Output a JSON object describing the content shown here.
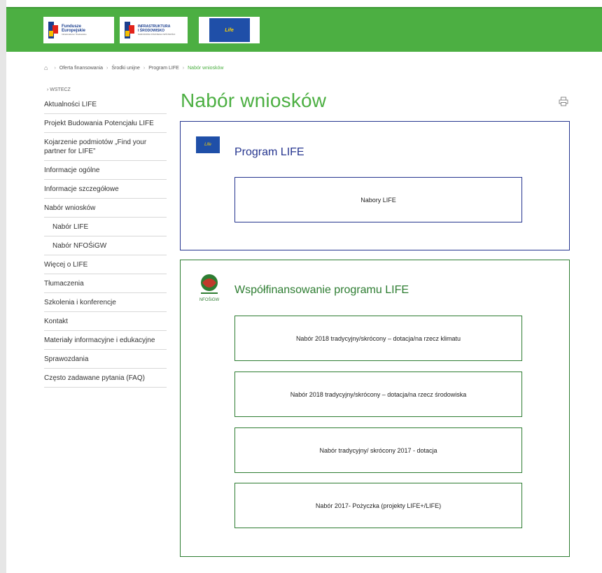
{
  "header": {
    "logo1": {
      "line1": "Fundusze",
      "line2": "Europejskie",
      "line3": "Infrastruktura i Środowisko"
    },
    "logo2": {
      "line1": "INFRASTRUKTURA",
      "line2": "I ŚRODOWISKO",
      "line3": "NARODOWA STRATEGIA SPÓJNOŚCI"
    },
    "logo3": {
      "text": "Life"
    }
  },
  "breadcrumb": {
    "items": [
      "Oferta finansowania",
      "Środki unijne",
      "Program LIFE"
    ],
    "current": "Nabór wniosków"
  },
  "sidebar": {
    "back": "WSTECZ",
    "items": [
      {
        "label": "Aktualności LIFE"
      },
      {
        "label": "Projekt Budowania Potencjału LIFE"
      },
      {
        "label": "Kojarzenie podmiotów „Find your partner for LIFE”"
      },
      {
        "label": "Informacje ogólne"
      },
      {
        "label": "Informacje szczegółowe"
      },
      {
        "label": "Nabór wniosków"
      },
      {
        "label": "Nabór LIFE"
      },
      {
        "label": "Nabór NFOŚiGW"
      },
      {
        "label": "Więcej o LIFE"
      },
      {
        "label": "Tłumaczenia"
      },
      {
        "label": "Szkolenia i konferencje"
      },
      {
        "label": "Kontakt"
      },
      {
        "label": "Materiały informacyjne i edukacyjne"
      },
      {
        "label": "Sprawozdania"
      },
      {
        "label": "Często zadawane pytania (FAQ)"
      }
    ]
  },
  "page": {
    "title": "Nabór wniosków"
  },
  "sections": {
    "life": {
      "title": "Program LIFE",
      "icon_label": "Life",
      "buttons": [
        "Nabory LIFE"
      ]
    },
    "nfos": {
      "title": "Współfinansowanie programu LIFE",
      "icon_label": "NFOŚiGW",
      "buttons": [
        "Nabór 2018 tradycyjny/skrócony – dotacja/na rzecz klimatu",
        "Nabór 2018 tradycyjny/skrócony – dotacja/na rzecz środowiska",
        "Nabór tradycyjny/ skrócony 2017 - dotacja",
        "Nabór 2017- Pożyczka (projekty LIFE+/LIFE)"
      ]
    }
  },
  "colors": {
    "green": "#4caf42",
    "dark_green": "#2e7d32",
    "navy": "#25358f"
  }
}
